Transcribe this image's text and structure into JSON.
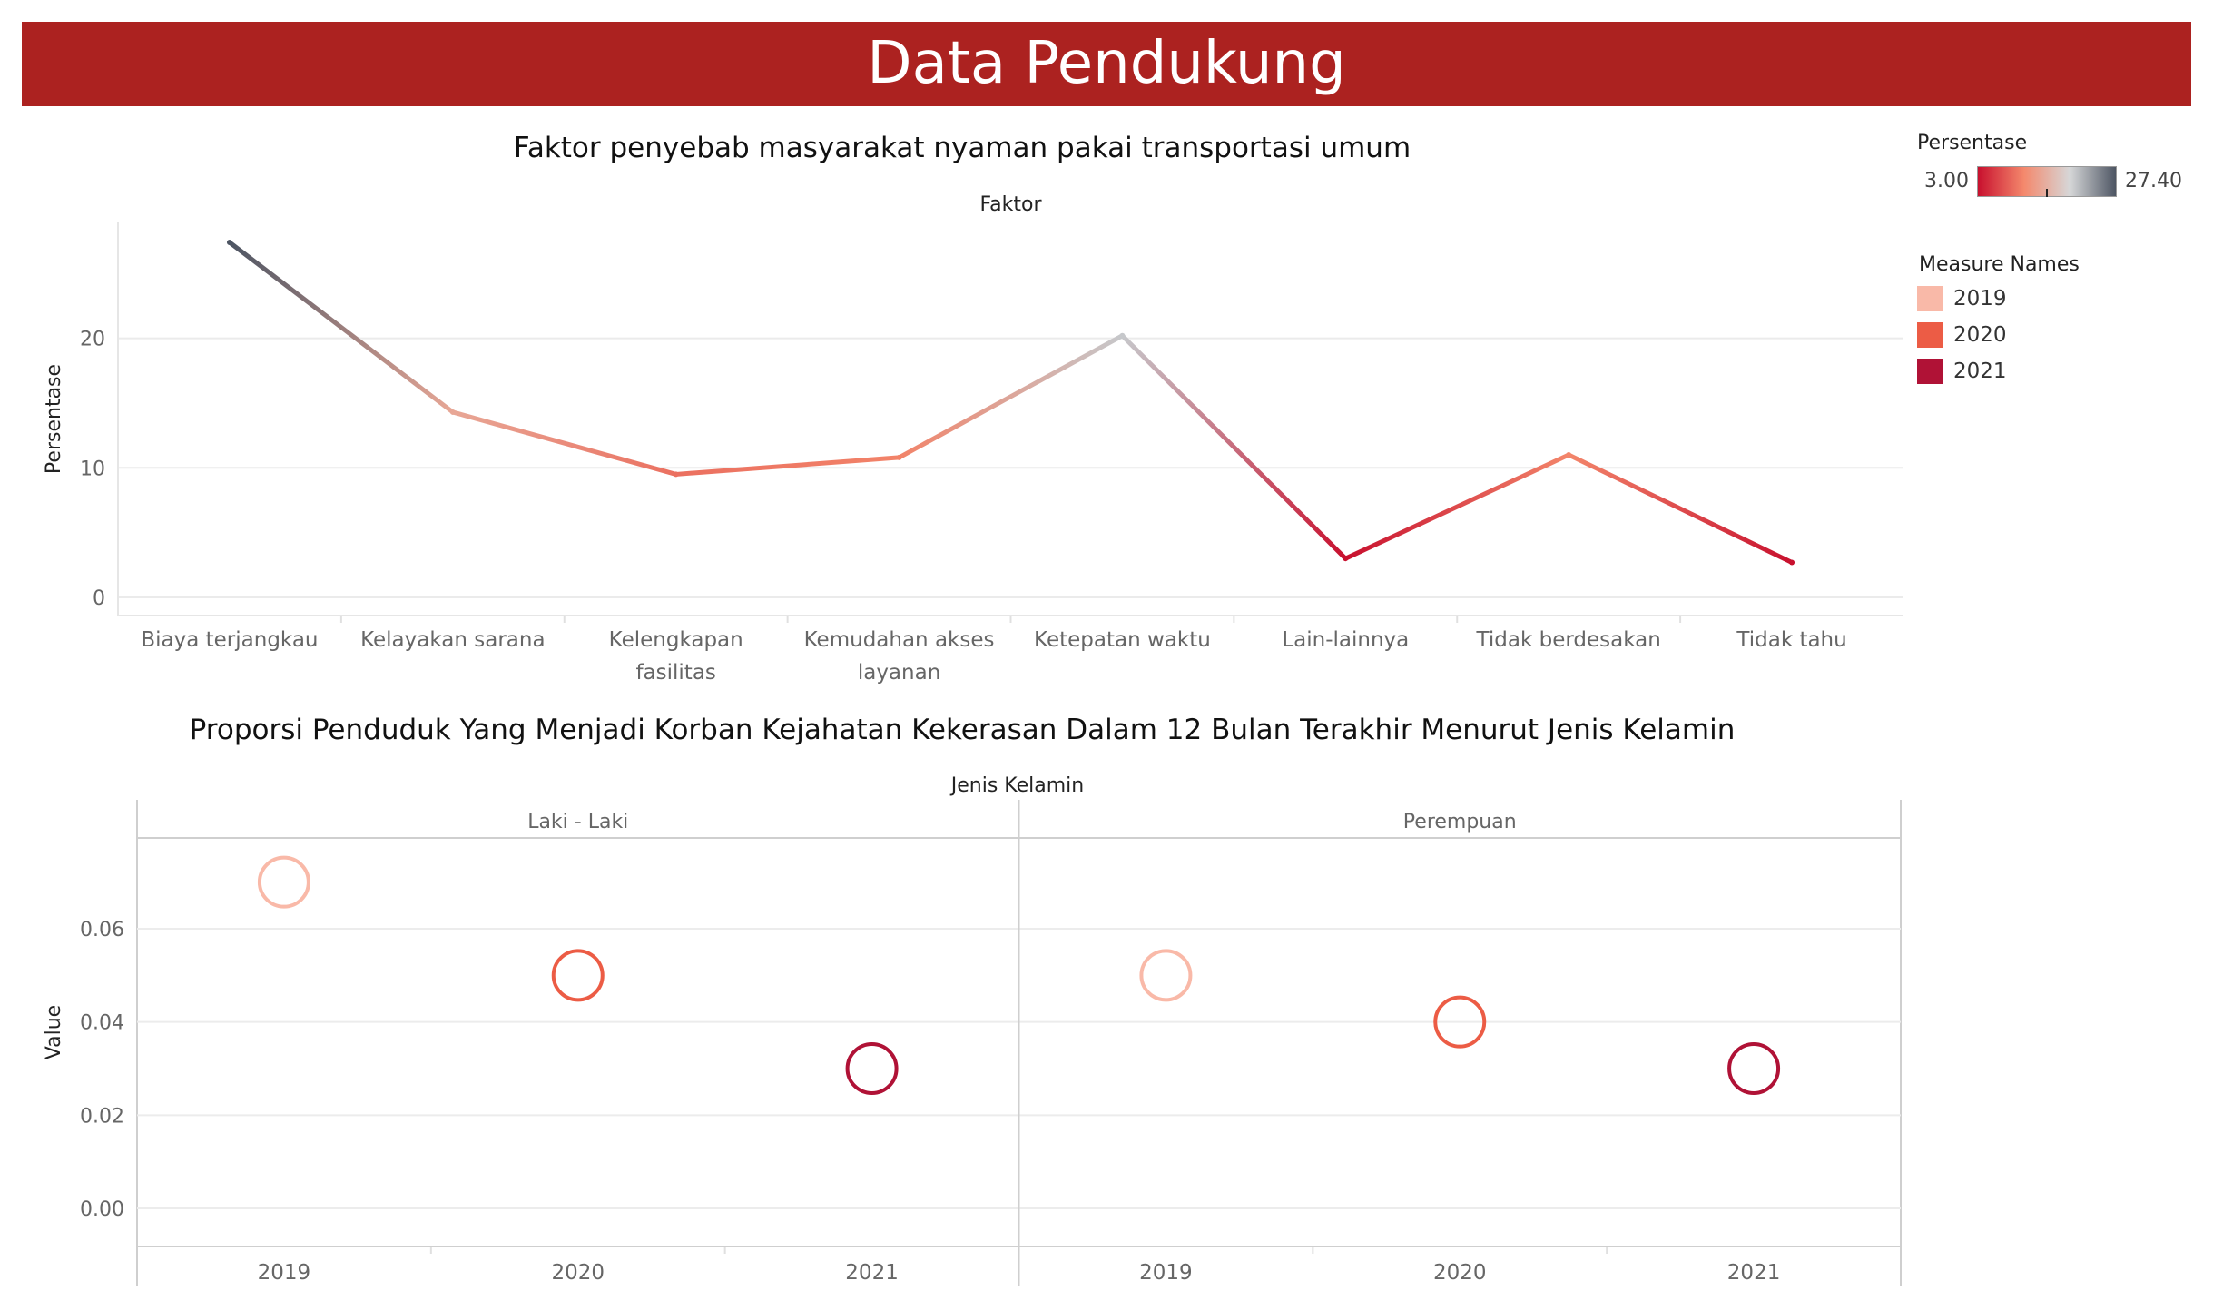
{
  "header": {
    "title": "Data Pendukung"
  },
  "legend": {
    "color_title": "Persentase",
    "color_min": "3.00",
    "color_max": "27.40",
    "gradient_colors": [
      "#c8102e",
      "#f4886c",
      "#d6d7d8",
      "#4d5563"
    ],
    "measure_title": "Measure Names",
    "measures": [
      {
        "label": "2019",
        "color": "#f9b9a8"
      },
      {
        "label": "2020",
        "color": "#ec5c45"
      },
      {
        "label": "2021",
        "color": "#b01236"
      }
    ]
  },
  "chart_data": [
    {
      "type": "line",
      "title": "Faktor penyebab masyarakat nyaman pakai transportasi umum",
      "column_header": "Faktor",
      "ylabel": "Persentase",
      "ylim": [
        0,
        27.4
      ],
      "yticks": [
        "0",
        "10",
        "20"
      ],
      "categories": [
        "Biaya terjangkau",
        "Kelayakan sarana",
        "Kelengkapan fasilitas",
        "Kemudahan akses layanan",
        "Ketepatan waktu",
        "Lain-lainnya",
        "Tidak berdesakan",
        "Tidak tahu"
      ],
      "category_lines": [
        [
          "Biaya terjangkau"
        ],
        [
          "Kelayakan sarana"
        ],
        [
          "Kelengkapan",
          "fasilitas"
        ],
        [
          "Kemudahan akses",
          "layanan"
        ],
        [
          "Ketepatan waktu"
        ],
        [
          "Lain-lainnya"
        ],
        [
          "Tidak berdesakan"
        ],
        [
          "Tidak tahu"
        ]
      ],
      "values": [
        27.4,
        14.3,
        9.5,
        10.8,
        20.2,
        3.0,
        11.0,
        2.7
      ],
      "grid": true
    },
    {
      "type": "scatter",
      "title": "Proporsi Penduduk Yang Menjadi Korban Kejahatan Kekerasan Dalam 12 Bulan Terakhir Menurut Jenis Kelamin",
      "column_header": "Jenis Kelamin",
      "ylabel": "Value",
      "ylim": [
        0,
        0.08
      ],
      "yticks": [
        "0.00",
        "0.02",
        "0.04",
        "0.06"
      ],
      "panels": [
        {
          "name": "Laki - Laki",
          "x": [
            "2019",
            "2020",
            "2021"
          ],
          "values": [
            0.07,
            0.05,
            0.03
          ]
        },
        {
          "name": "Perempuan",
          "x": [
            "2019",
            "2020",
            "2021"
          ],
          "values": [
            0.05,
            0.04,
            0.03
          ]
        }
      ],
      "grid": true
    }
  ]
}
